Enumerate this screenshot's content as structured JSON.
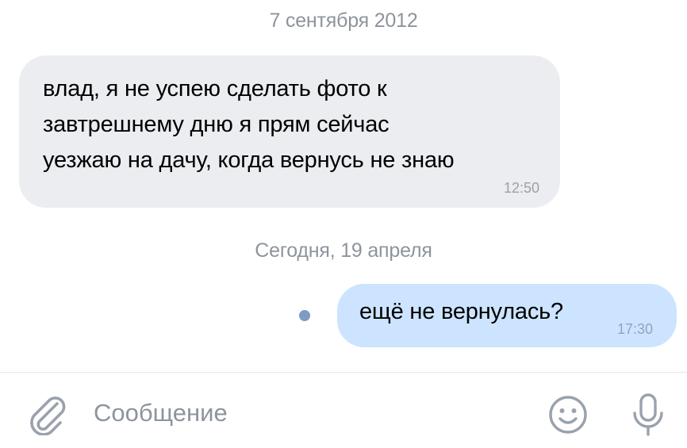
{
  "chat": {
    "messages": [
      {
        "date_separator": "7 сентября 2012",
        "direction": "incoming",
        "text": "влад, я не успею сделать фото к\nзавтрешнему дню я прям сейчас\nуезжаю на дачу, когда вернусь не знаю",
        "time": "12:50"
      },
      {
        "date_separator": "Сегодня, 19 апреля",
        "direction": "outgoing",
        "text": "ещё не вернулась?",
        "time": "17:30",
        "unread": true
      }
    ]
  },
  "composer": {
    "placeholder": "Сообщение",
    "value": "",
    "icons": [
      "paperclip-icon",
      "smiley-icon",
      "microphone-icon"
    ]
  },
  "colors": {
    "incoming_bubble": "#ebedf0",
    "outgoing_bubble": "#cce4ff",
    "unread_dot": "#7d9bc4",
    "icon_gray": "#99a2ad",
    "secondary_text": "#8e949c"
  }
}
